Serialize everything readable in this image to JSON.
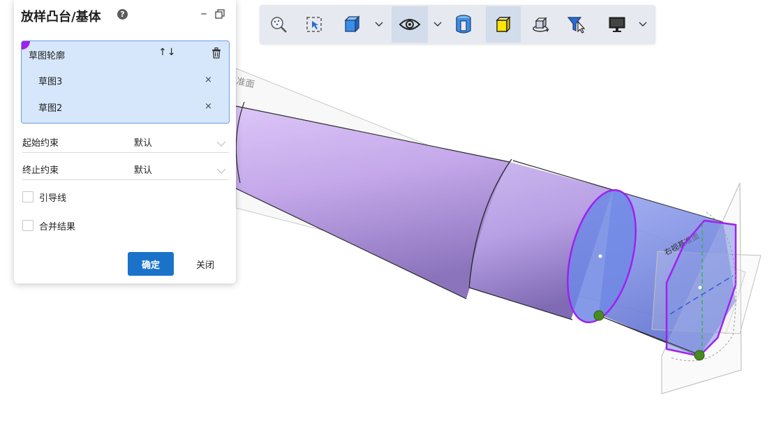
{
  "panel": {
    "title": "放样凸台/基体",
    "profile": {
      "header": "草图轮廓",
      "items": [
        {
          "label": "草图3",
          "remove": "×"
        },
        {
          "label": "草图2",
          "remove": "×"
        }
      ]
    },
    "start_constraint": {
      "label": "起始约束",
      "value": "默认"
    },
    "end_constraint": {
      "label": "终止约束",
      "value": "默认"
    },
    "guide_lines": {
      "label": "引导线",
      "checked": false
    },
    "merge_result": {
      "label": "合并结果",
      "checked": false
    },
    "ok_label": "确定",
    "close_label": "关闭"
  },
  "viewport": {
    "plane_label_1": "准面",
    "plane_label_2": "右视基准面"
  },
  "colors": {
    "accent": "#1a73c9",
    "profile_bg": "#d6e7fb",
    "cylinder": "#c4aae8",
    "loft": "#7c8fe0",
    "highlight": "#a020f0",
    "point": "#4a8a1e"
  },
  "toolbar": {
    "icons": [
      "zoom-fit-icon",
      "zoom-area-icon",
      "view-orientation-icon",
      "display-style-icon",
      "section-view-icon",
      "edit-appearance-icon",
      "apply-scene-icon",
      "selection-filter-icon",
      "view-settings-icon"
    ]
  }
}
